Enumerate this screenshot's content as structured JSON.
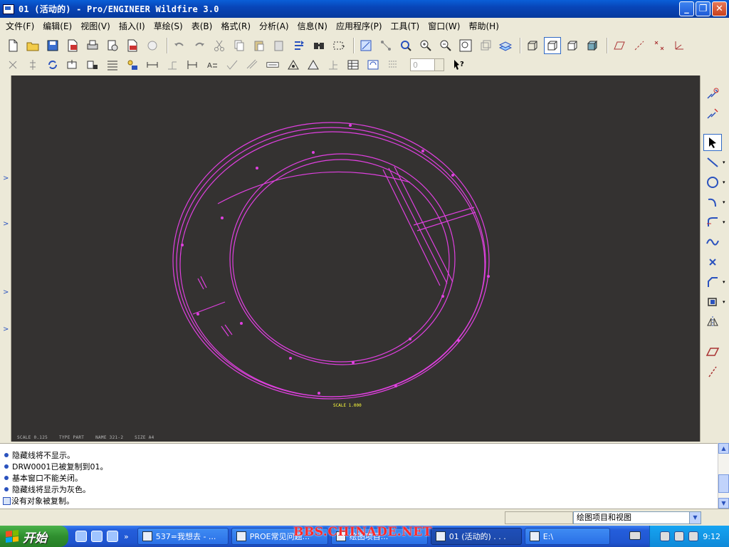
{
  "window": {
    "title": "01 (活动的) - Pro/ENGINEER Wildfire 3.0",
    "min_label": "_",
    "max_label": "❐",
    "close_label": "✕"
  },
  "menu": {
    "items": [
      "文件(F)",
      "编辑(E)",
      "视图(V)",
      "插入(I)",
      "草绘(S)",
      "表(B)",
      "格式(R)",
      "分析(A)",
      "信息(N)",
      "应用程序(P)",
      "工具(T)",
      "窗口(W)",
      "帮助(H)"
    ]
  },
  "toolbar": {
    "spinner_value": "0"
  },
  "drawing": {
    "footer": [
      "SCALE 0.125",
      "TYPE PART",
      "NAME 321-2",
      "SIZE A4"
    ],
    "scale_label": "SCALE 1.000",
    "line_color": "#e040e0",
    "background": "#343231"
  },
  "messages": {
    "lines": [
      "隐藏线将不显示。",
      "DRW0001已被复制到01。",
      "基本窗口不能关闭。",
      "隐藏线将显示为灰色。",
      "没有对象被复制。"
    ]
  },
  "status": {
    "filter_value": "绘图项目和视图"
  },
  "taskbar": {
    "start_label": "开始",
    "tasks": [
      "537=我想去 - ...",
      "PROE常见问题...",
      "绘图项目...",
      "01 (活动的) . . .",
      "E:\\"
    ],
    "watermark": "BBS.CHINADE.NET",
    "clock": "9:12"
  }
}
